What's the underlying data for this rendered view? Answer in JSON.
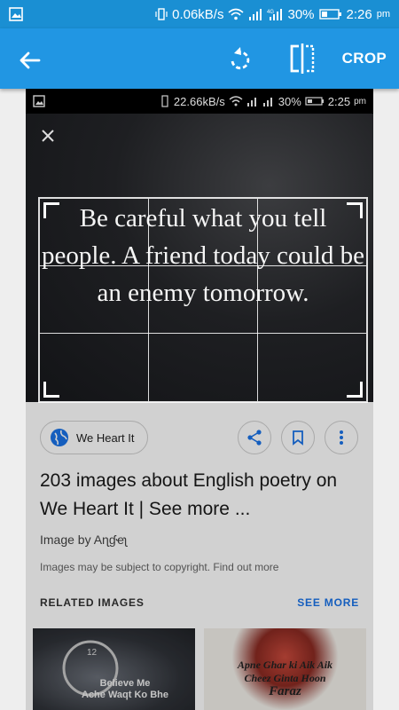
{
  "statusbar": {
    "net_speed": "0.06kB/s",
    "battery": "30%",
    "time": "2:26",
    "time_suffix": "pm"
  },
  "appbar": {
    "crop_label": "CROP"
  },
  "screenshot": {
    "status": {
      "net_speed": "22.66kB/s",
      "battery": "30%",
      "time": "2:25",
      "time_suffix": "pm"
    },
    "quote": "Be careful what you tell people. A friend today could be an enemy tomorrow.",
    "source_chip": "We Heart It",
    "title": "203 images about English poetry on We Heart It | See more ...",
    "image_by": "Image by Aɳɠҽʅ",
    "copyright": "Images may be subject to copyright. Find out more",
    "related_label": "RELATED IMAGES",
    "see_more": "SEE MORE",
    "thumb1_text": "Believe Me\nAche Waqt Ko Bhe",
    "thumb2_line1": "Apne Ghar ki Aik Aik",
    "thumb2_line2": "Cheez Ginta Hoon",
    "thumb2_line3": "Faraz"
  },
  "colors": {
    "appbar": "#2196e3",
    "statusbar": "#1a8fd3",
    "link": "#1a73e8"
  }
}
